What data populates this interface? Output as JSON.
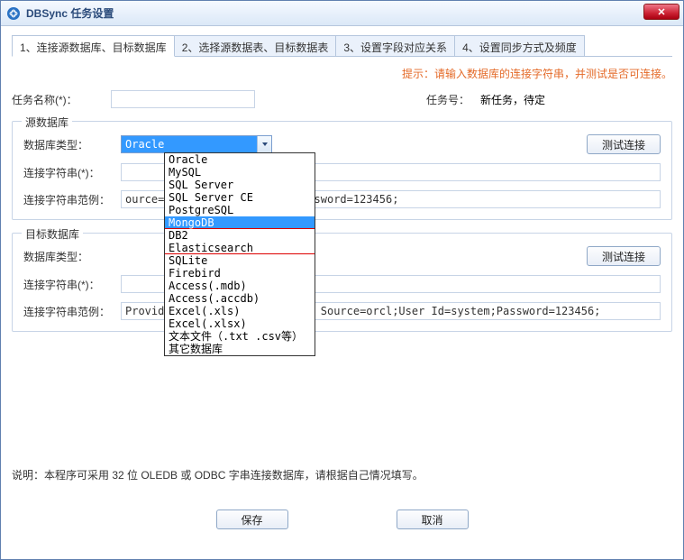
{
  "window": {
    "title": "DBSync 任务设置",
    "close_glyph": "✕"
  },
  "tabs": {
    "t1": "1、连接源数据库、目标数据库",
    "t2": "2、选择源数据表、目标数据表",
    "t3": "3、设置字段对应关系",
    "t4": "4、设置同步方式及频度",
    "active_index": 0
  },
  "hint": "提示：请输入数据库的连接字符串，并测试是否可连接。",
  "task": {
    "name_label": "任务名称(*)：",
    "no_label": "任务号：",
    "no_value": "新任务，待定"
  },
  "source": {
    "legend": "源数据库",
    "dbtype_label": "数据库类型：",
    "dbtype_value": "Oracle",
    "test_btn": "测试连接",
    "conn_label": "连接字符串(*)：",
    "example_label": "连接字符串范例：",
    "example_value": "ource=orcl;User Id=system;Password=123456;"
  },
  "target": {
    "legend": "目标数据库",
    "dbtype_label": "数据库类型：",
    "test_btn": "测试连接",
    "conn_label": "连接字符串(*)：",
    "example_label": "连接字符串范例：",
    "example_value": "Provider=OraOLEDB.Oracle;Data Source=orcl;User Id=system;Password=123456;"
  },
  "dropdown": {
    "options": [
      "Oracle",
      "MySQL",
      "SQL Server",
      "SQL Server CE",
      "PostgreSQL",
      "MongoDB",
      "DB2",
      "Elasticsearch",
      "SQLite",
      "Firebird",
      "Access(.mdb)",
      "Access(.accdb)",
      "Excel(.xls)",
      "Excel(.xlsx)",
      "文本文件（.txt .csv等）",
      "其它数据库"
    ],
    "highlighted_index": 5,
    "red_underline_indices": [
      5,
      7
    ]
  },
  "footer_note": "说明：本程序可采用 32 位 OLEDB 或 ODBC 字串连接数据库，请根据自己情况填写。",
  "buttons": {
    "save": "保存",
    "cancel": "取消"
  }
}
